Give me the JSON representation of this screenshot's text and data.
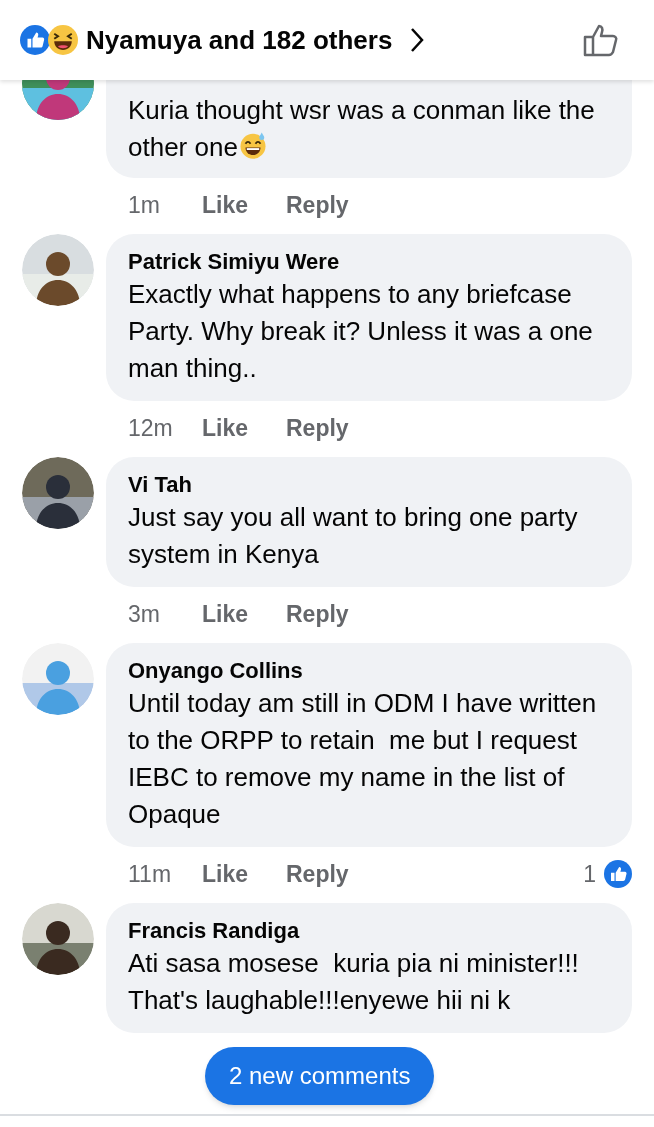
{
  "header": {
    "reactions": [
      {
        "kind": "like"
      },
      {
        "kind": "haha"
      }
    ],
    "summary": "Nyamuya and 182 others"
  },
  "comments": [
    {
      "text": "Kuria thought wsr was a conman like the other one",
      "trailing_emoji": true,
      "time": "1m",
      "like": "Like",
      "reply": "Reply"
    },
    {
      "author": "Patrick Simiyu Were",
      "text": "Exactly what happens to any briefcase Party. Why break it? Unless it was a one man thing..",
      "time": "12m",
      "like": "Like",
      "reply": "Reply"
    },
    {
      "author": "Vi Tah",
      "text": "Just say you all want to bring one party system in Kenya",
      "time": "3m",
      "like": "Like",
      "reply": "Reply"
    },
    {
      "author": "Onyango Collins",
      "text": "Until today am still in ODM I have written to the ORPP to retain  me but I request IEBC to remove my name in the list of Opaque",
      "time": "11m",
      "like": "Like",
      "reply": "Reply",
      "reaction_count": "1"
    },
    {
      "author": "Francis Randiga",
      "text": "Ati sasa mosese  kuria pia ni minister!!! That's laughable!!!enyewe hii ni k"
    }
  ],
  "new_comments_button": "2 new comments"
}
